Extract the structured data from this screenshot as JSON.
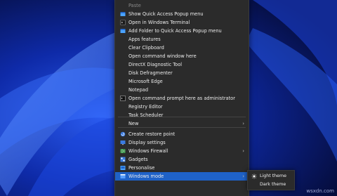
{
  "context_menu": {
    "items": [
      {
        "label": "Paste",
        "disabled": true
      },
      {
        "label": "Show Quick Access Popup menu",
        "icon": "popup-icon"
      },
      {
        "label": "Open in Windows Terminal",
        "icon": "terminal-icon"
      },
      {
        "label": "Add Folder to Quick Access Popup menu",
        "icon": "popup-icon"
      },
      {
        "label": "Apps features"
      },
      {
        "label": "Clear Clipboard"
      },
      {
        "label": "Open command window here"
      },
      {
        "label": "DirectX Diagnostic Tool"
      },
      {
        "label": "Disk Defragmenter"
      },
      {
        "label": "Microsoft Edge"
      },
      {
        "label": "Notepad"
      },
      {
        "label": "Open command prompt here as administrator",
        "icon": "cmd-icon"
      },
      {
        "label": "Registry Editor"
      },
      {
        "label": "Task Scheduler"
      },
      {
        "label": "New",
        "submenu": true
      },
      {
        "label": "Create restore point",
        "icon": "restore-icon"
      },
      {
        "label": "Display settings",
        "icon": "display-icon"
      },
      {
        "label": "Windows Firewall",
        "icon": "firewall-icon",
        "submenu": true
      },
      {
        "label": "Gadgets",
        "icon": "gadgets-icon"
      },
      {
        "label": "Personalise",
        "icon": "personalise-icon"
      },
      {
        "label": "Windows mode",
        "icon": "windows-mode-icon",
        "submenu": true,
        "highlighted": true
      }
    ]
  },
  "windows_mode_submenu": {
    "items": [
      {
        "label": "Light theme",
        "icon": "sun-icon"
      },
      {
        "label": "Dark theme"
      }
    ]
  },
  "watermark": "wsxdn.com",
  "colors": {
    "menu_bg": "#2b2b2b",
    "highlight": "#1f62c8",
    "text": "#ececec",
    "desktop": "#0a1a6e"
  }
}
